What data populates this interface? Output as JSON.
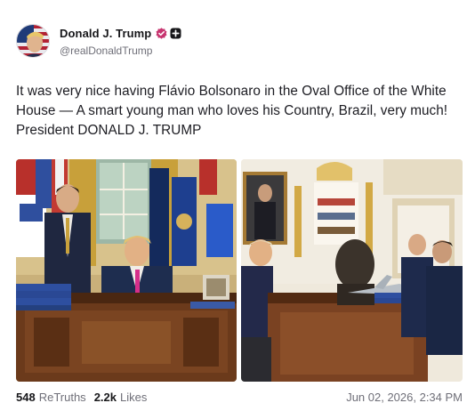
{
  "author": {
    "display_name": "Donald J. Trump",
    "handle": "@realDonaldTrump"
  },
  "post": {
    "text": "It was very nice having Flávio Bolsonaro in the Oval Office of the White House — A smart young man who loves his Country, Brazil, very much! President DONALD J. TRUMP"
  },
  "media": {
    "count": 2
  },
  "stats": {
    "retruths_count": "548",
    "retruths_label": "ReTruths",
    "likes_count": "2.2k",
    "likes_label": "Likes",
    "timestamp": "Jun 02, 2026, 2:34 PM"
  },
  "colors": {
    "verified": "#c7346f",
    "text": "#17171a",
    "muted": "#6f6f78"
  },
  "icons": {
    "verified": "verified-badge-icon",
    "plus": "plus-badge-icon"
  }
}
